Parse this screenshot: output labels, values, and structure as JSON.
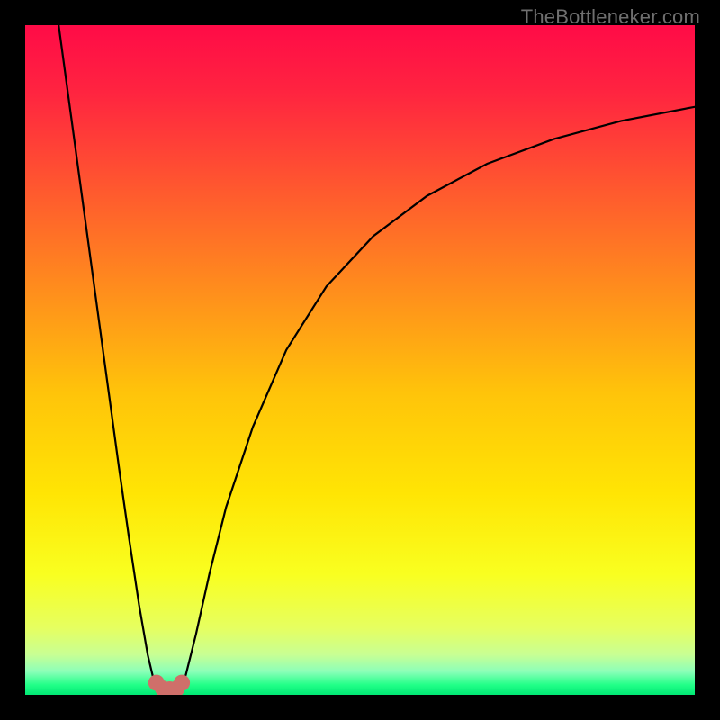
{
  "watermark": "TheBottleneker.com",
  "chart_data": {
    "type": "line",
    "title": "",
    "xlabel": "",
    "ylabel": "",
    "xlim": [
      0,
      100
    ],
    "ylim": [
      0,
      100
    ],
    "grid": false,
    "legend": false,
    "annotations": [],
    "background": {
      "type": "vertical-gradient",
      "stops": [
        {
          "pos": 0.0,
          "color": "#ff0b47"
        },
        {
          "pos": 0.1,
          "color": "#ff2440"
        },
        {
          "pos": 0.25,
          "color": "#ff5a2e"
        },
        {
          "pos": 0.4,
          "color": "#ff8f1c"
        },
        {
          "pos": 0.55,
          "color": "#ffc40a"
        },
        {
          "pos": 0.7,
          "color": "#ffe504"
        },
        {
          "pos": 0.82,
          "color": "#f9ff20"
        },
        {
          "pos": 0.9,
          "color": "#e6ff60"
        },
        {
          "pos": 0.94,
          "color": "#c8ff94"
        },
        {
          "pos": 0.965,
          "color": "#8cffb9"
        },
        {
          "pos": 0.985,
          "color": "#22ff88"
        },
        {
          "pos": 1.0,
          "color": "#00e874"
        }
      ]
    },
    "series": [
      {
        "name": "left-branch",
        "color": "#000000",
        "width": 2.2,
        "x": [
          5.0,
          6.5,
          8.0,
          9.5,
          11.0,
          12.5,
          14.0,
          15.5,
          17.0,
          18.3,
          19.2,
          19.8
        ],
        "y": [
          100.0,
          89.0,
          78.0,
          67.0,
          56.0,
          45.0,
          34.0,
          23.5,
          13.5,
          6.0,
          2.2,
          0.8
        ]
      },
      {
        "name": "right-branch",
        "color": "#000000",
        "width": 2.2,
        "x": [
          23.2,
          24.0,
          25.5,
          27.5,
          30.0,
          34.0,
          39.0,
          45.0,
          52.0,
          60.0,
          69.0,
          79.0,
          89.0,
          100.0
        ],
        "y": [
          0.8,
          3.0,
          9.0,
          18.0,
          28.0,
          40.0,
          51.5,
          61.0,
          68.5,
          74.5,
          79.3,
          83.0,
          85.7,
          87.8
        ]
      },
      {
        "name": "valley-marker",
        "type": "scatter",
        "color": "#cf6f6a",
        "radius": 9,
        "x": [
          19.6,
          20.6,
          21.6,
          22.6,
          23.4
        ],
        "y": [
          1.8,
          0.9,
          0.8,
          0.9,
          1.8
        ]
      }
    ]
  }
}
